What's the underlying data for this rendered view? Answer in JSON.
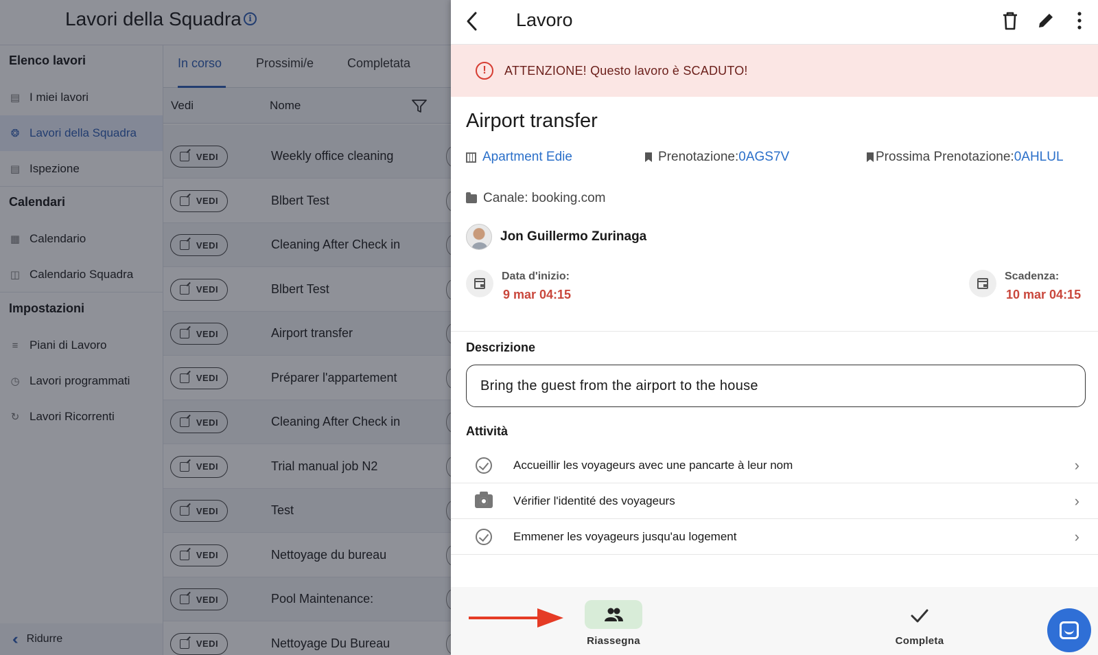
{
  "left_app": {
    "title": "Lavori della Squadra",
    "info_icon": "info-circle-icon",
    "sidebar": {
      "sections": [
        {
          "title": "Elenco lavori",
          "items": [
            {
              "label": "I miei lavori",
              "icon": "id-badge-icon"
            },
            {
              "label": "Lavori della Squadra",
              "icon": "team-circle-icon",
              "active": true
            },
            {
              "label": "Ispezione",
              "icon": "clipboard-icon"
            }
          ]
        },
        {
          "title": "Calendari",
          "items": [
            {
              "label": "Calendario",
              "icon": "calendar-icon"
            },
            {
              "label": "Calendario Squadra",
              "icon": "calendar-columns-icon"
            }
          ]
        },
        {
          "title": "Impostazioni",
          "items": [
            {
              "label": "Piani di Lavoro",
              "icon": "checklist-icon"
            },
            {
              "label": "Lavori programmati",
              "icon": "clock-icon"
            },
            {
              "label": "Lavori Ricorrenti",
              "icon": "refresh-icon"
            }
          ]
        }
      ],
      "collapse_label": "Ridurre"
    },
    "tabs": [
      "In corso",
      "Prossimi/e",
      "Completata"
    ],
    "active_tab": "In corso",
    "list_header": {
      "col_vedi": "Vedi",
      "col_nome": "Nome"
    },
    "vedi_label": "VEDI",
    "rows": [
      "Weekly office cleaning",
      "Blbert Test",
      "Cleaning After Check in",
      "Blbert Test",
      "Airport transfer",
      "Préparer l'appartement",
      "Cleaning After Check in",
      "Trial manual job N2",
      "Test",
      "Nettoyage du bureau",
      "Pool Maintenance:",
      "Nettoyage Du Bureau"
    ]
  },
  "drawer": {
    "title": "Lavoro",
    "actions": [
      "trash-icon",
      "pencil-icon",
      "more-vertical-icon"
    ],
    "alert": {
      "text": "ATTENZIONE! Questo lavoro è SCADUTO!",
      "color": "#fbe6e4"
    },
    "job_title": "Airport transfer",
    "property_link": "Apartment Edie",
    "booking": {
      "label": "Prenotazione: ",
      "code": "0AGS7V"
    },
    "next_booking": {
      "label": "Prossima Prenotazione: ",
      "code": "0AHLUL"
    },
    "channel": "Canale: booking.com",
    "assignee": "Jon Guillermo Zurinaga",
    "start": {
      "label": "Data d'inizio:",
      "value": "9 mar 04:15"
    },
    "due": {
      "label": "Scadenza:",
      "value": "10 mar 04:15"
    },
    "description_label": "Descrizione",
    "description": "Bring the guest from the airport to the house",
    "activities_label": "Attività",
    "activities": [
      {
        "text": "Accueillir les voyageurs avec une pancarte à leur nom",
        "icon": "check-circle-icon"
      },
      {
        "text": "Vérifier l'identité des voyageurs",
        "icon": "camera-icon"
      },
      {
        "text": "Emmener les voyageurs jusqu'au logement",
        "icon": "check-circle-icon"
      }
    ],
    "reassign_label": "Riassegna",
    "complete_label": "Completa",
    "accent": "#2a6fc9",
    "danger": "#c9473c"
  }
}
